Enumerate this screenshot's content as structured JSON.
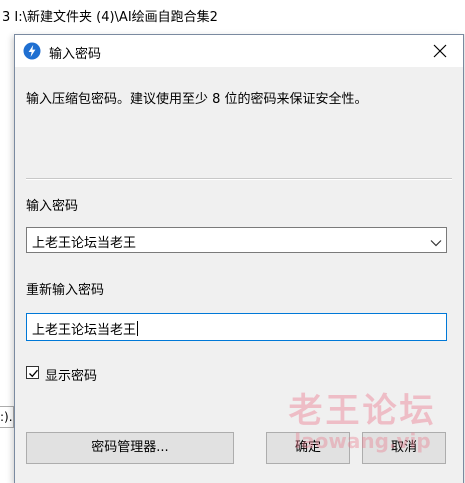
{
  "background": {
    "path_text": "3   I:\\新建文件夹 (4)\\AI绘画自跑合集2",
    "left_fragment": "‎:)..."
  },
  "dialog": {
    "title": "输入密码",
    "description": "输入压缩包密码。建议使用至少 8 位的密码来保证安全性。",
    "password_label": "输入密码",
    "password_value": "上老王论坛当老王",
    "reenter_label": "重新输入密码",
    "reenter_value": "上老王论坛当老王",
    "show_password_label": "显示密码",
    "show_password_checked": true,
    "buttons": {
      "manager": "密码管理器...",
      "ok": "确定",
      "cancel": "取消"
    }
  },
  "watermark": {
    "main": "老王论坛",
    "sub": "laowang.vip"
  },
  "icons": {
    "app": "lightning-bolt-icon",
    "close": "close-icon",
    "dropdown": "chevron-down-icon",
    "check": "checkmark-icon"
  },
  "colors": {
    "accent": "#0078d7",
    "app_icon": "#1f6fd1",
    "watermark": "#eb788c"
  }
}
